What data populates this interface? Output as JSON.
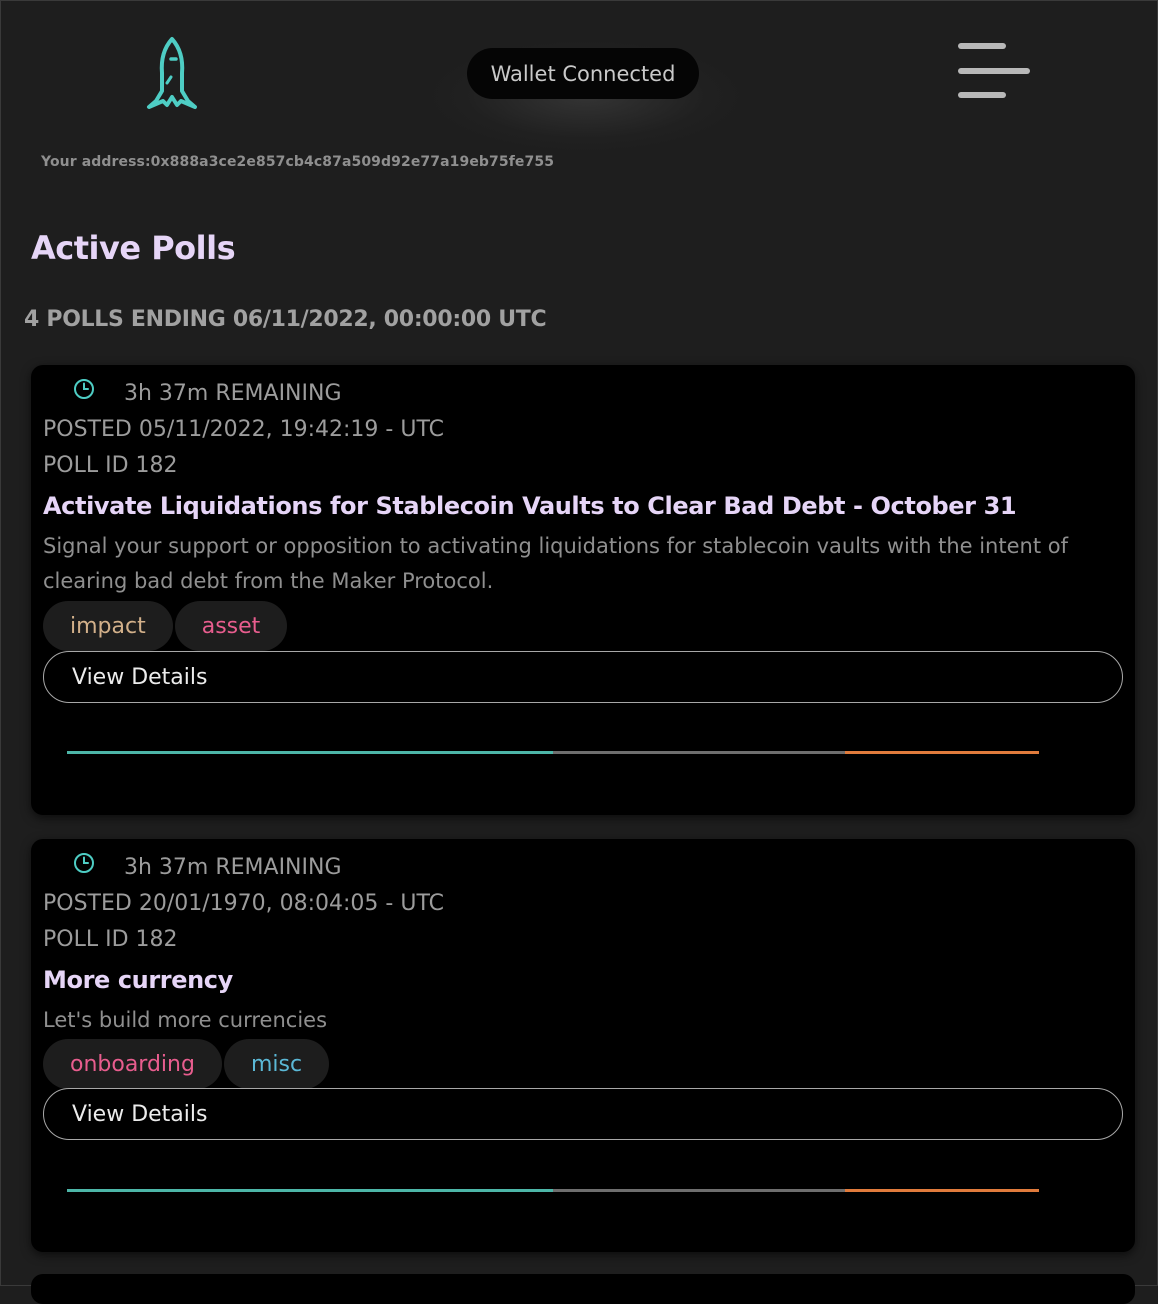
{
  "header": {
    "logo_icon": "rocket-icon",
    "wallet_status": "Wallet Connected",
    "menu_icon": "hamburger-menu-icon",
    "address_text": "Your address:0x888a3ce2e857cb4c87a509d92e77a19eb75fe755"
  },
  "page": {
    "title": "Active Polls",
    "ending_text": "4 POLLS ENDING 06/11/2022, 00:00:00 UTC"
  },
  "colors": {
    "accent_teal": "#4ecdc4",
    "title_lavender": "#e6d5f7",
    "vote_yes": "#4db6a8",
    "vote_abstain": "#6e6e6e",
    "vote_no": "#e07b3c"
  },
  "polls": [
    {
      "remaining": "3h 37m REMAINING",
      "posted": "POSTED 05/11/2022, 19:42:19 - UTC",
      "poll_id": "POLL ID 182",
      "title": "Activate Liquidations for Stablecoin Vaults to Clear Bad Debt - October 31",
      "description": "Signal your support or opposition to activating liquidations for stablecoin vaults with the intent of clearing bad debt from the Maker Protocol.",
      "tags": [
        {
          "label": "impact",
          "color": "#d2b08a"
        },
        {
          "label": "asset",
          "color": "#e85d8e"
        }
      ],
      "view_details": "View Details",
      "vote_split": {
        "yes": 0.5,
        "abstain": 0.3,
        "no": 0.2
      }
    },
    {
      "remaining": "3h 37m REMAINING",
      "posted": "POSTED 20/01/1970, 08:04:05 - UTC",
      "poll_id": "POLL ID 182",
      "title": "More currency",
      "description": "Let's build more currencies",
      "tags": [
        {
          "label": "onboarding",
          "color": "#e85d8e"
        },
        {
          "label": "misc",
          "color": "#5bb8d6"
        }
      ],
      "view_details": "View Details",
      "vote_split": {
        "yes": 0.5,
        "abstain": 0.3,
        "no": 0.2
      }
    }
  ]
}
